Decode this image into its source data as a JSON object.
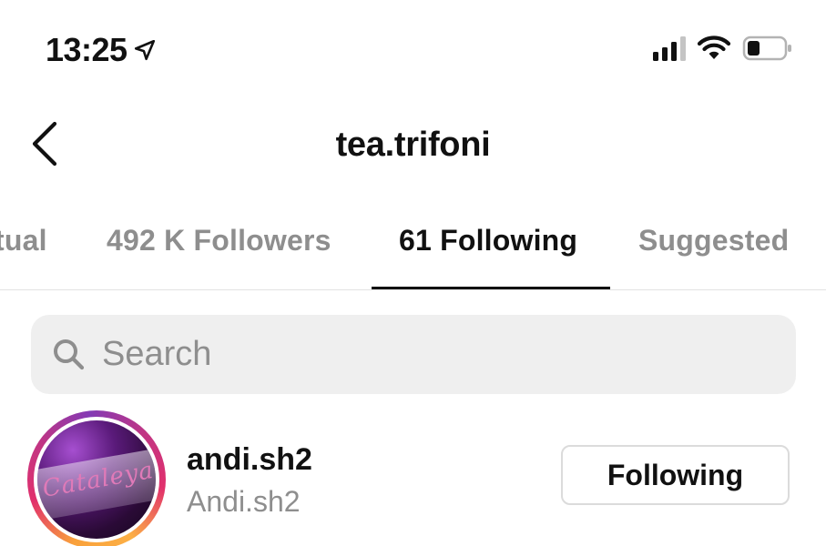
{
  "status_bar": {
    "time": "13:25",
    "icons": [
      "location-arrow-icon",
      "cellular-signal-icon",
      "wifi-icon",
      "battery-icon"
    ]
  },
  "header": {
    "title": "tea.trifoni",
    "back_icon": "chevron-left-icon"
  },
  "tabs": [
    {
      "label": "tual",
      "active": false
    },
    {
      "label": "492 K Followers",
      "active": false
    },
    {
      "label": "61 Following",
      "active": true
    },
    {
      "label": "Suggested",
      "active": false
    }
  ],
  "search": {
    "placeholder": "Search",
    "value": "",
    "icon": "search-icon"
  },
  "users": [
    {
      "username": "andi.sh2",
      "full_name": "Andi.sh2",
      "button_label": "Following",
      "avatar_text": "Cataleya"
    }
  ],
  "colors": {
    "text": "#111111",
    "muted": "#8e8e8e",
    "search_bg": "#efefef",
    "divider": "#e2e2e2",
    "button_border": "#dbdbdb"
  }
}
